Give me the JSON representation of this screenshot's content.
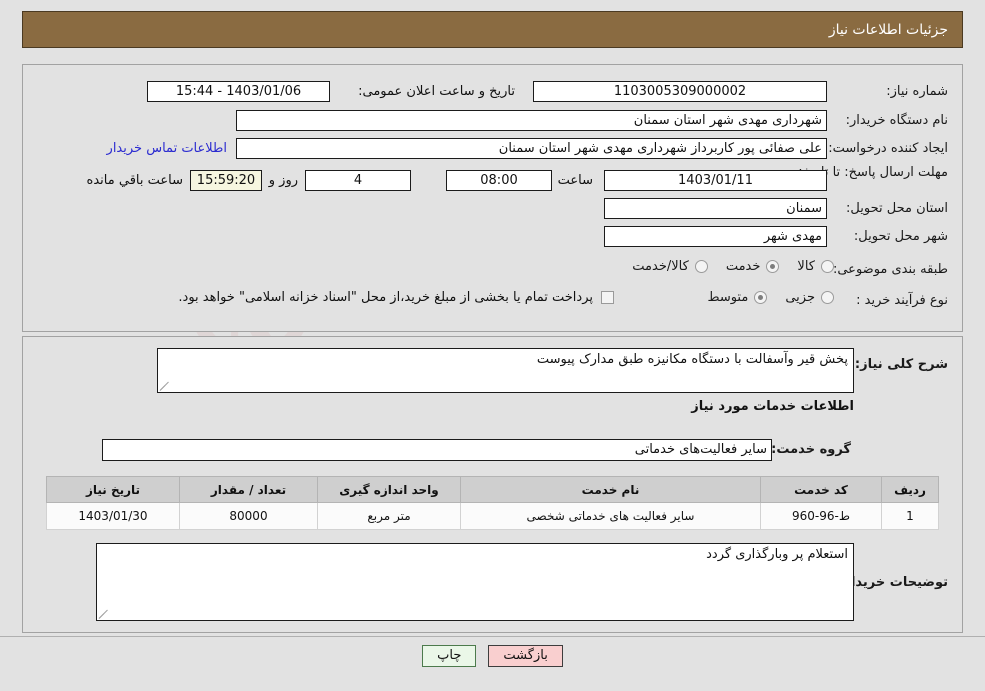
{
  "header": {
    "title": "جزئیات اطلاعات نیاز"
  },
  "form": {
    "need_number_label": "شماره نیاز:",
    "need_number_value": "1103005309000002",
    "announce_datetime_label": "تاریخ و ساعت اعلان عمومی:",
    "announce_datetime_value": "1403/01/06 - 15:44",
    "buyer_org_label": "نام دستگاه خریدار:",
    "buyer_org_value": "شهرداری مهدی شهر استان سمنان",
    "creator_label": "ایجاد کننده درخواست:",
    "creator_value": "علی صفائی پور کاربرداز شهرداری مهدی شهر استان سمنان",
    "contact_link": "اطلاعات تماس خریدار",
    "deadline_label": "مهلت ارسال پاسخ: تا تاریخ:",
    "deadline_date": "1403/01/11",
    "hour_label": "ساعت",
    "hour_value": "08:00",
    "days_value": "4",
    "days_unit_label": "روز و",
    "countdown_value": "15:59:20",
    "remaining_label": "ساعت باقي مانده",
    "province_label": "استان محل تحویل:",
    "province_value": "سمنان",
    "city_label": "شهر محل تحویل:",
    "city_value": "مهدی شهر",
    "category_label": "طبقه بندی موضوعی:",
    "category_options": [
      {
        "label": "کالا",
        "selected": false
      },
      {
        "label": "خدمت",
        "selected": true
      },
      {
        "label": "کالا/خدمت",
        "selected": false
      }
    ],
    "process_label": "نوع فرآیند خرید :",
    "process_options": [
      {
        "label": "جزیی",
        "selected": false
      },
      {
        "label": "متوسط",
        "selected": true
      }
    ],
    "treasury_checked": false,
    "treasury_text": "پرداخت تمام یا بخشی از مبلغ خرید،از محل \"اسناد خزانه اسلامی\" خواهد بود."
  },
  "description": {
    "label": "شرح کلی نیاز:",
    "value": "پخش قیر وآسفالت با دستگاه مکانیزه طبق مدارک پیوست"
  },
  "services": {
    "section_title": "اطلاعات خدمات مورد نیاز",
    "group_label": "گروه خدمت:",
    "group_value": "سایر فعالیت‌های خدماتی",
    "table": {
      "columns": [
        "ردیف",
        "کد خدمت",
        "نام خدمت",
        "واحد اندازه گیری",
        "تعداد / مقدار",
        "تاریخ نیاز"
      ],
      "rows": [
        {
          "row_no": "1",
          "service_code": "ط-96-960",
          "service_name": "سایر فعالیت های خدماتی شخصی",
          "unit": "متر مربع",
          "quantity": "80000",
          "need_date": "1403/01/30"
        }
      ]
    }
  },
  "buyer_notes": {
    "label": "توضیحات خریدار:",
    "value": "استعلام پر وبارگذاری گردد"
  },
  "footer": {
    "back_label": "بازگشت",
    "print_label": "چاپ"
  },
  "watermark": {
    "text": "AriaTender.net"
  },
  "colors": {
    "header_bg": "#8a6b41",
    "page_bg": "#e2e2e2",
    "link": "#2b2bd0",
    "timer_bg": "#f6f6e0",
    "back_btn_bg": "#f9cfcf",
    "print_btn_bg": "#eaf7e8"
  }
}
